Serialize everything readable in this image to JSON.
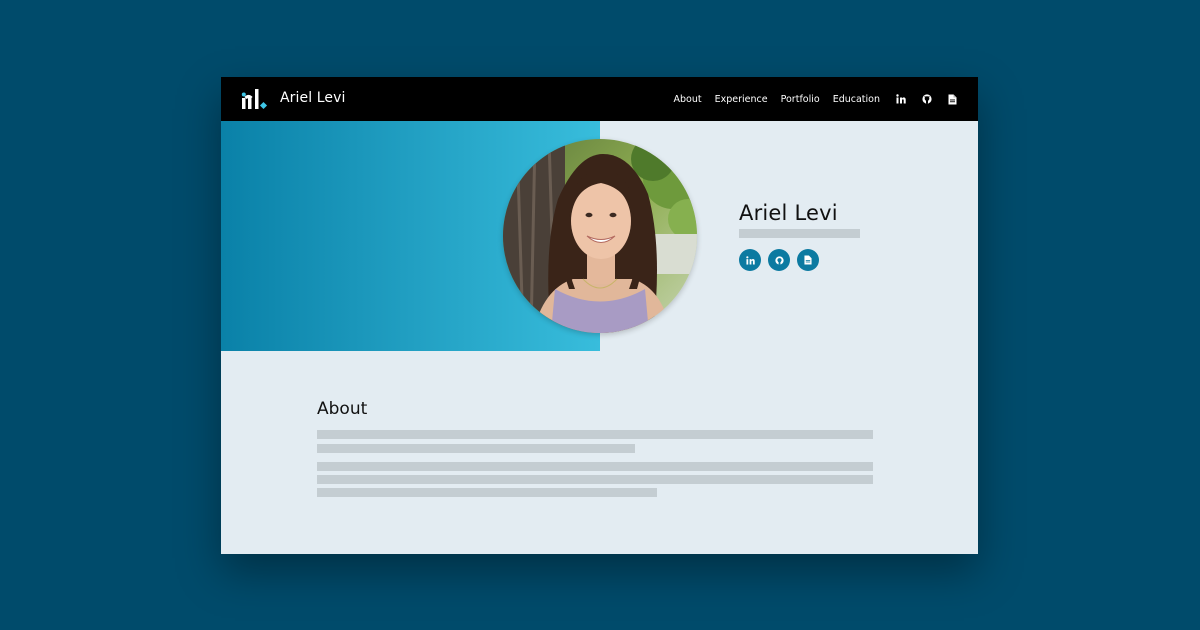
{
  "brand": {
    "name": "Ariel Levi",
    "logo_icon": "al-monogram-logo-icon"
  },
  "nav": {
    "links": [
      "About",
      "Experience",
      "Portfolio",
      "Education"
    ],
    "icons": [
      "linkedin-icon",
      "github-icon",
      "resume-document-icon"
    ]
  },
  "hero": {
    "name": "Ariel Levi",
    "tagline": "",
    "social": [
      "linkedin-icon",
      "github-icon",
      "resume-document-icon"
    ],
    "photo": "profile-photo"
  },
  "about": {
    "title": "About",
    "paragraphs": [
      "",
      ""
    ]
  },
  "colors": {
    "page_background": "#004b6b",
    "navbar": "#000000",
    "hero_gradient_start": "#0a81a8",
    "hero_gradient_end": "#38bddc",
    "content_background": "#e3ecf2",
    "accent": "#0c7aa1",
    "placeholder_text": "#c4cdd2"
  }
}
